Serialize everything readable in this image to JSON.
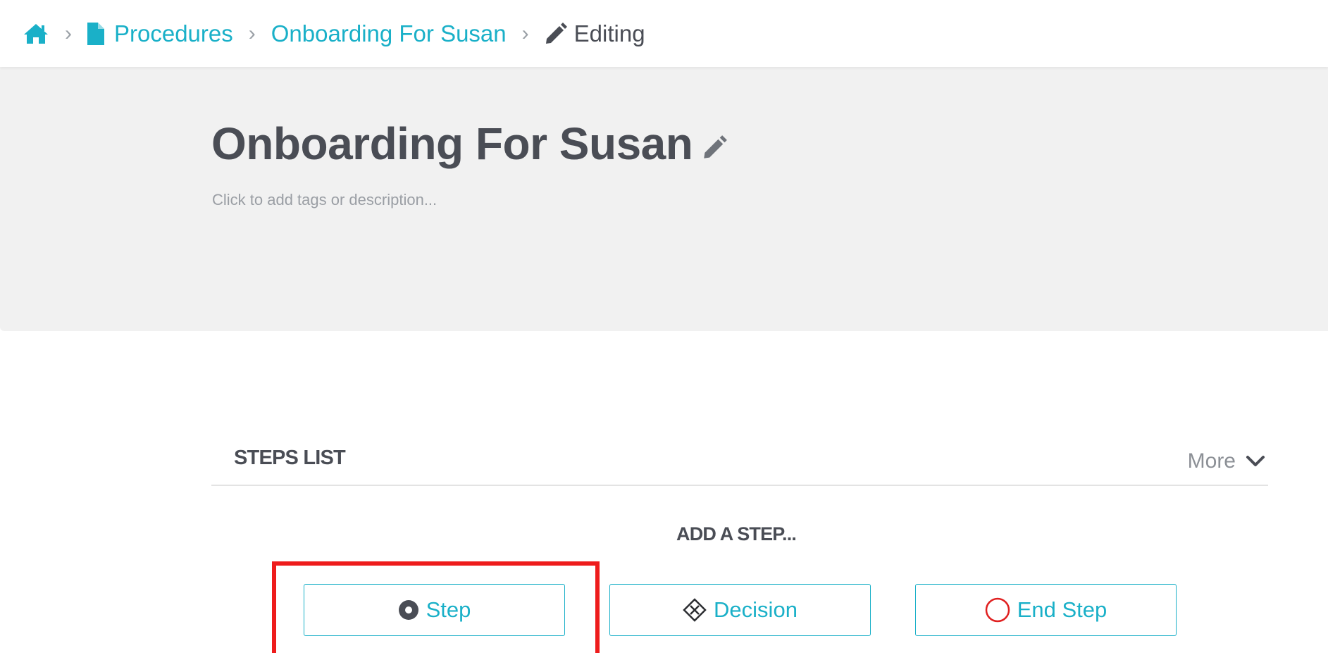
{
  "breadcrumb": {
    "home_icon": "home-icon",
    "items": [
      {
        "label": "Procedures",
        "icon": "document-icon"
      },
      {
        "label": "Onboarding For Susan"
      }
    ],
    "current": {
      "label": "Editing",
      "icon": "pencil-icon"
    },
    "separator": "›"
  },
  "procedure": {
    "title": "Onboarding For Susan",
    "description_placeholder": "Click to add tags or description..."
  },
  "steps_list": {
    "title": "STEPS LIST",
    "more_label": "More"
  },
  "add_step": {
    "label": "ADD A STEP...",
    "buttons": {
      "step": "Step",
      "decision": "Decision",
      "end_step": "End Step"
    }
  },
  "colors": {
    "accent": "#1ab0c8",
    "text": "#4a4d55",
    "panel_bg": "#f1f1f1",
    "end_icon": "#e02020",
    "highlight": "#ee1c1c"
  }
}
